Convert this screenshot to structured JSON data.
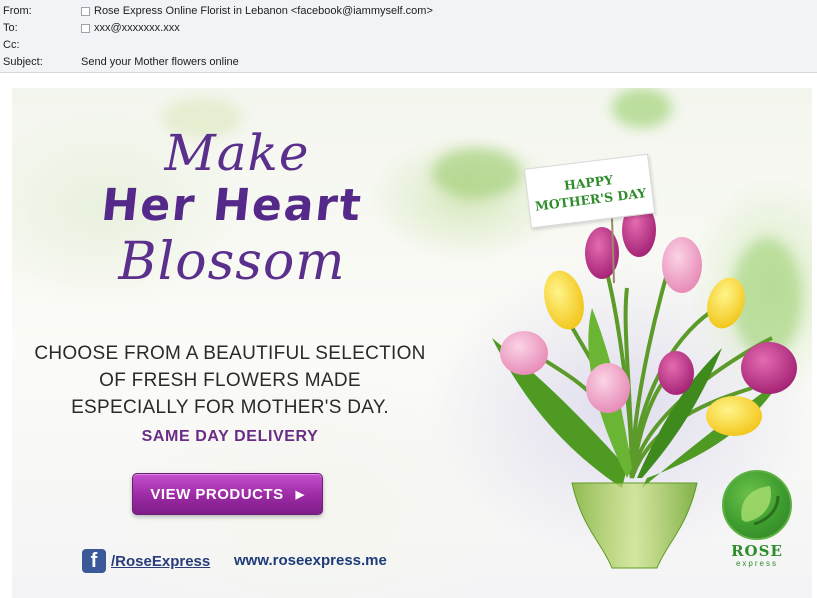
{
  "header": {
    "from_label": "From:",
    "from_value": "Rose Express Online Florist in Lebanon <facebook@iammyself.com>",
    "to_label": "To:",
    "to_value": "xxx@xxxxxxx.xxx",
    "cc_label": "Cc:",
    "cc_value": "",
    "subject_label": "Subject:",
    "subject_value": "Send your Mother flowers online"
  },
  "banner": {
    "headline_line1": "Make",
    "headline_line2": "Her Heart",
    "headline_line3": "Blossom",
    "copy_line1": "CHOOSE FROM A BEAUTIFUL SELECTION",
    "copy_line2": "OF FRESH FLOWERS MADE",
    "copy_line3": "ESPECIALLY FOR MOTHER'S DAY.",
    "same_day": "SAME DAY DELIVERY",
    "button_label": "VIEW PRODUCTS",
    "button_arrow": "▶",
    "facebook_glyph": "f",
    "facebook_link": "/RoseExpress",
    "website": "www.roseexpress.me",
    "card_line1": "HAPPY",
    "card_line2": "MOTHER'S DAY",
    "logo_name": "ROSE",
    "logo_sub": "express"
  },
  "colors": {
    "headline": "#5b2f8c",
    "accent_purple": "#9b2aa4",
    "brand_green": "#2f8c2a",
    "facebook_blue": "#3b5998"
  },
  "icons": {
    "checkbox": "checkbox-icon",
    "facebook": "facebook-icon",
    "arrow": "arrow-right-icon",
    "logo": "rose-express-logo"
  }
}
